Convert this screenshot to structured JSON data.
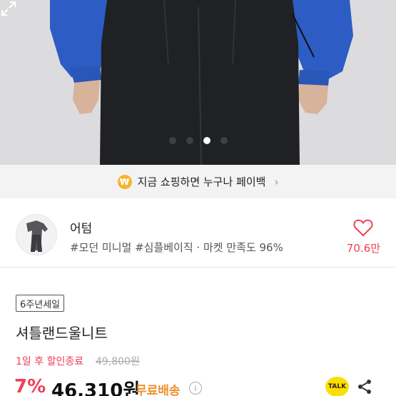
{
  "carousel": {
    "slide_count": 4,
    "active_index": 2
  },
  "promo": {
    "icon_text": "₩",
    "text": "지금 쇼핑하면 누구나 페이백",
    "chevron": "›"
  },
  "shop": {
    "name": "어텀",
    "tags": "#모던 미니멀 #심플베이직 · 마켓 만족도 96%",
    "likes": "70.6만"
  },
  "product": {
    "badge": "6주년세일",
    "title": "셔틀랜드울니트",
    "deadline": "1일 후 할인종료",
    "original_price": "49,800원",
    "discount": "7%",
    "price": "46,310원",
    "shipping": "무료배송",
    "info_icon_text": "i",
    "talk_label": "TALK"
  },
  "colors": {
    "accent": "#ef4056",
    "shipping": "#ef8f2a",
    "kakao": "#f9e000",
    "payback": "#f6b531"
  }
}
